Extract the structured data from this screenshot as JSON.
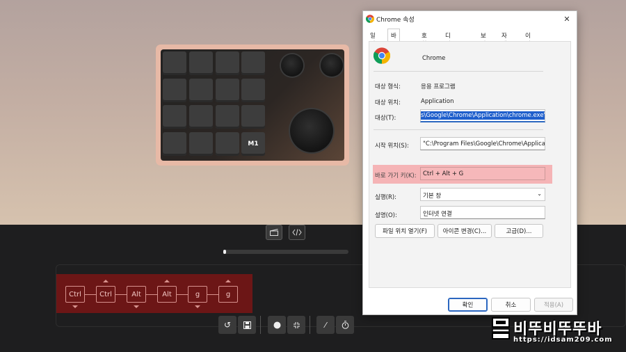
{
  "device": {
    "m1_label": "M1"
  },
  "editor": {
    "progress": 0.02
  },
  "macro_keys": [
    "Ctrl",
    "Ctrl",
    "Alt",
    "Alt",
    "g",
    "g"
  ],
  "dialog": {
    "title": "Chrome 속성",
    "tabs": [
      "일반",
      "바로 가기",
      "호환성",
      "디지털 서명",
      "보안",
      "자세히",
      "이전 버전"
    ],
    "active_tab": "바로 가기",
    "app_name": "Chrome",
    "target_type_label": "대상 형식:",
    "target_type_value": "응용 프로그램",
    "target_location_label": "대상 위치:",
    "target_location_value": "Application",
    "target_label": "대상(T):",
    "target_value": "s\\Google\\Chrome\\Application\\chrome.exe\"",
    "start_in_label": "시작 위치(S):",
    "start_in_value": "\"C:\\Program Files\\Google\\Chrome\\Applicati",
    "shortcut_key_label": "바로 가기 키(K):",
    "shortcut_key_value": "Ctrl + Alt + G",
    "run_label": "실행(R):",
    "run_value": "기본 창",
    "comment_label": "설명(O):",
    "comment_value": "인터넷 연결",
    "open_location_button": "파일 위치 열기(F)",
    "change_icon_button": "아이콘 변경(C)...",
    "advanced_button": "고급(D)...",
    "ok_button": "확인",
    "cancel_button": "취소",
    "apply_button": "적용(A)"
  },
  "watermark": {
    "title": "비뚜비뚜뚜바",
    "url": "https://idsam209.com"
  },
  "colors": {
    "highlight": "#f5b4b6",
    "macro_strip": "#6c1616",
    "device_shell": "#e7b9a6"
  }
}
